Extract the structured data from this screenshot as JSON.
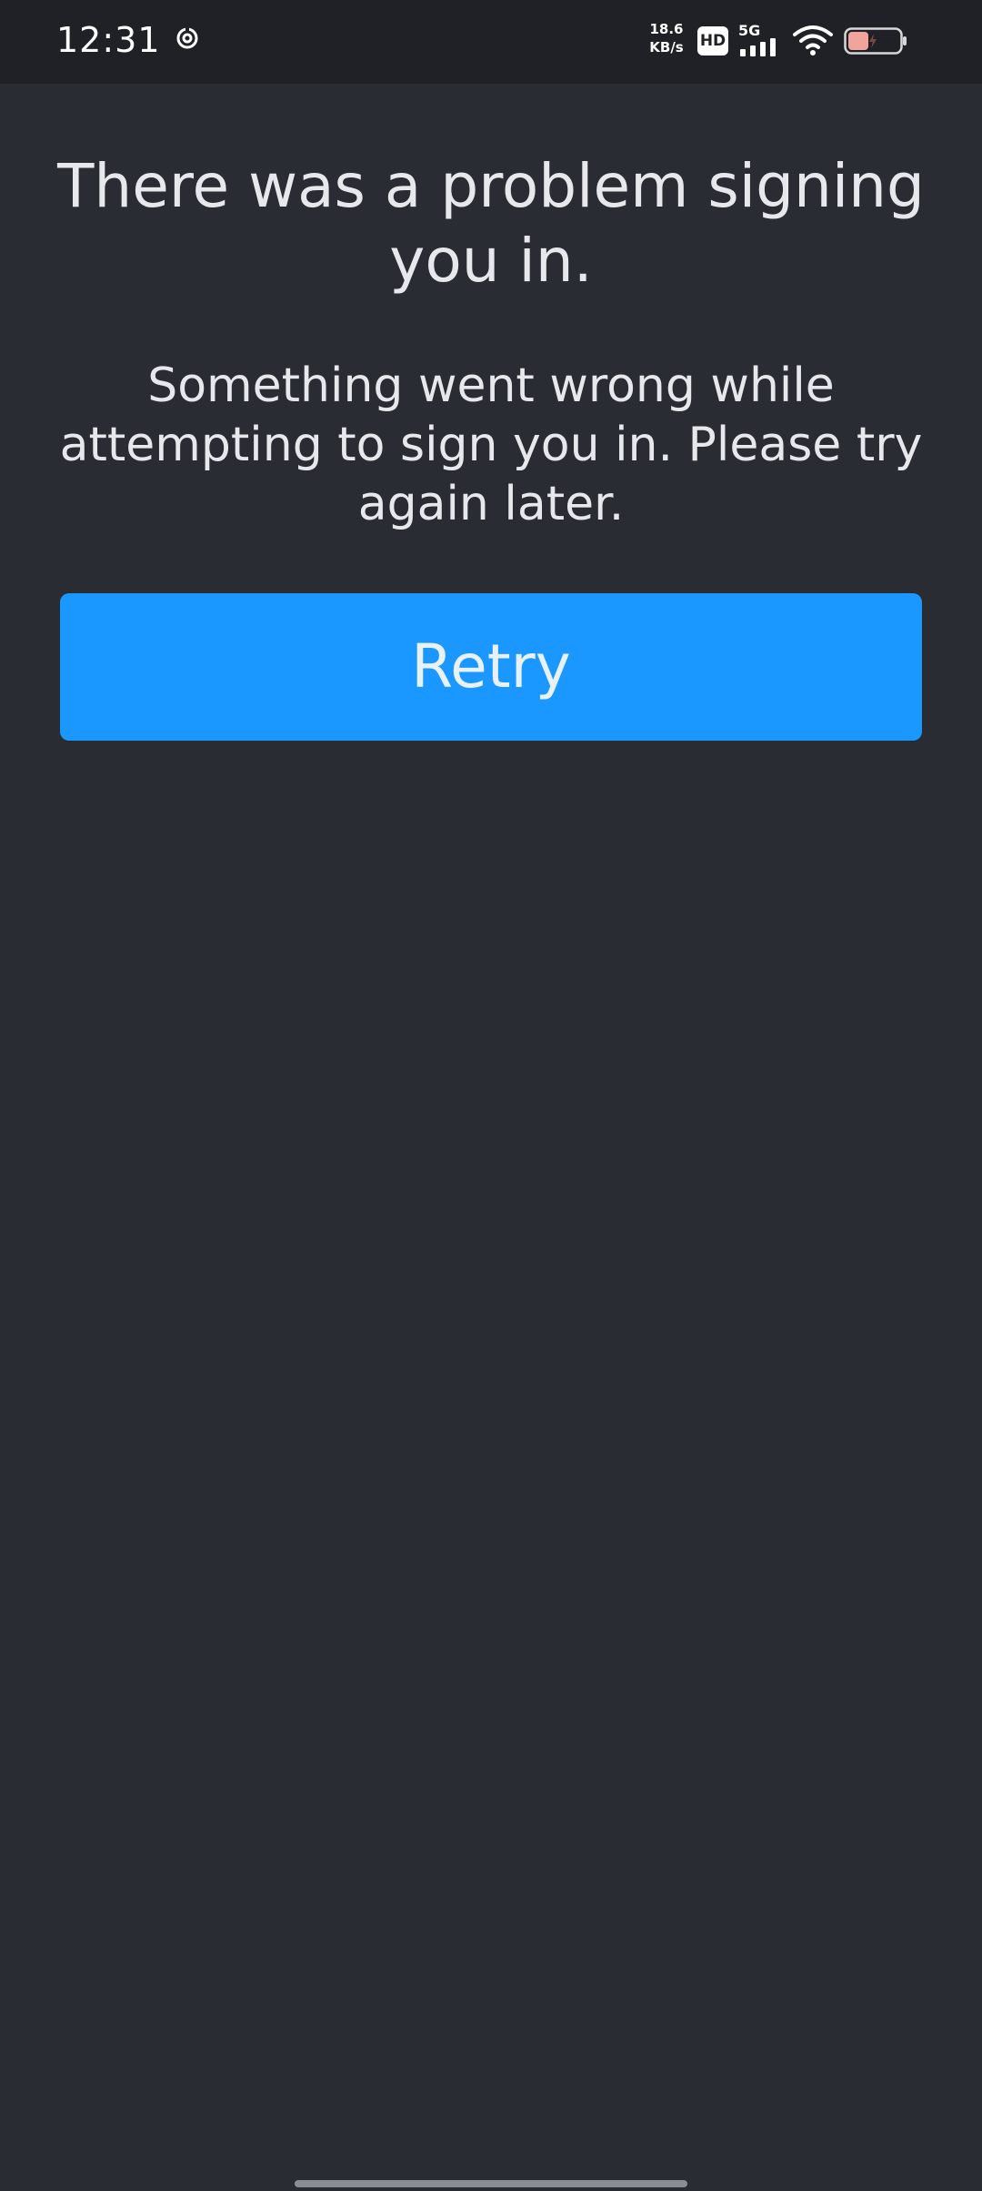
{
  "status_bar": {
    "time": "12:31",
    "net_speed_value": "18.6",
    "net_speed_unit": "KB/s",
    "hd_label": "HD",
    "network_label": "5G",
    "icons": [
      "sync-icon",
      "hd-icon",
      "signal-icon",
      "wifi-icon",
      "battery-icon"
    ],
    "battery_level": 0.4
  },
  "error": {
    "title": "There was a problem signing you in.",
    "message": "Something went wrong while attempting to sign you in. Please try again later.",
    "retry_label": "Retry"
  },
  "colors": {
    "background": "#292c33",
    "status_bar": "#1f2126",
    "accent": "#1a98ff",
    "text": "#e6e8ec",
    "battery_fill": "#f1a49b"
  }
}
